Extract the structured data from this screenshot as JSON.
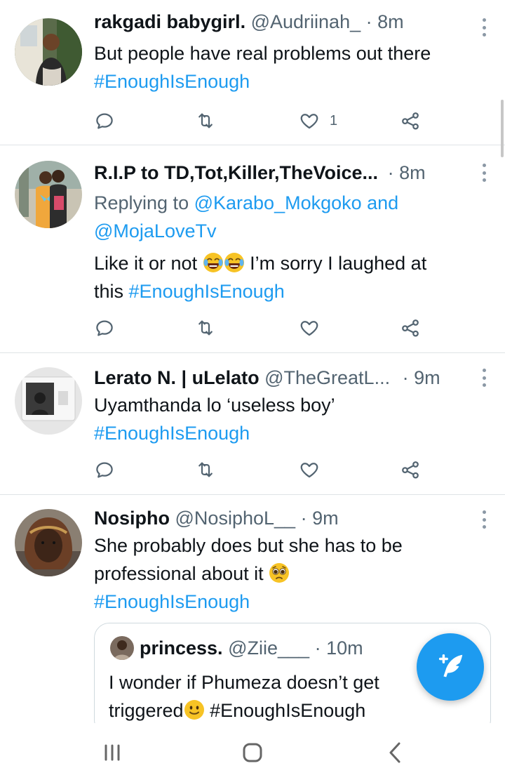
{
  "tweets": [
    {
      "name": "rakgadi babygirl.",
      "handle": "@Audriinah_",
      "time": "8m",
      "text1": "But people have real problems out there",
      "hashtag": "#EnoughIsEnough",
      "likes": "1"
    },
    {
      "name": "R.I.P to TD,Tot,Killer,TheVoice...",
      "time": "8m",
      "replying_prefix": "Replying to ",
      "reply_user1": "@Karabo_Mokgoko",
      "reply_and": " and",
      "reply_user2": "@MojaLoveTv",
      "text1": "Like it or not ",
      "text2": " I’m sorry I laughed at",
      "text3": "this ",
      "hashtag": "#EnoughIsEnough",
      "emoji": "joy-emoji"
    },
    {
      "name": "Lerato N. | uLelato",
      "handle": "@TheGreatL...",
      "time": "9m",
      "text1": "Uyamthanda lo ‘useless boy’",
      "hashtag": "#EnoughIsEnough"
    },
    {
      "name": "Nosipho",
      "handle": "@NosiphoL__",
      "time": "9m",
      "text1": "She probably does but she has to be",
      "text2": "professional about it ",
      "hashtag": "#EnoughIsEnough",
      "emoji": "pleading-face-emoji",
      "quote": {
        "name": "princess.",
        "handle": "@Ziie___",
        "time": "10m",
        "text1": "I wonder if Phumeza doesn’t get",
        "text2": "triggered",
        "hashtag": "#EnoughIsEnough",
        "emoji": "slightly-smiling-emoji"
      }
    }
  ],
  "separator": "·",
  "icons": {
    "reply": "reply-icon",
    "retweet": "retweet-icon",
    "like": "heart-icon",
    "share": "share-icon",
    "compose": "compose-tweet-icon",
    "more": "more-vertical-icon",
    "nav_recents": "recents-icon",
    "nav_home": "home-icon",
    "nav_back": "back-icon"
  },
  "colors": {
    "accent": "#1d9bf0",
    "text": "#0f1419",
    "secondary": "#536471",
    "divider": "#dfe3e6"
  }
}
